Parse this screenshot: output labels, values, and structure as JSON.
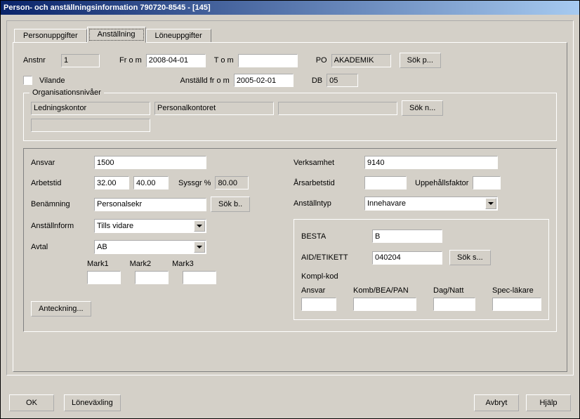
{
  "window": {
    "title": "Person- och anställningsinformation 790720-8545 - [145]"
  },
  "tabs": {
    "personuppgifter": "Personuppgifter",
    "anstallning": "Anställning",
    "loneuppgifter": "Löneuppgifter"
  },
  "top": {
    "anstnr_label": "Anstnr",
    "anstnr": "1",
    "from_label": "Fr o m",
    "from": "2008-04-01",
    "tom_label": "T o m",
    "tom": "",
    "po_label": "PO",
    "po": "AKADEMIK",
    "sokp_btn": "Sök p...",
    "vilande_label": "Vilande",
    "anstalld_from_label": "Anställd fr o m",
    "anstalld_from": "2005-02-01",
    "db_label": "DB",
    "db": "05"
  },
  "org": {
    "legend": "Organisationsnivåer",
    "n1": "Ledningskontor",
    "n2": "Personalkontoret",
    "n3": "",
    "n4": "",
    "sokn_btn": "Sök n..."
  },
  "left": {
    "ansvar_label": "Ansvar",
    "ansvar": "1500",
    "arbetstid_label": "Arbetstid",
    "arbetstid1": "32.00",
    "arbetstid2": "40.00",
    "syssgr_label": "Syssgr %",
    "syssgr": "80.00",
    "benamning_label": "Benämning",
    "benamning": "Personalsekr",
    "sokb_btn": "Sök b..",
    "anstallnform_label": "Anställnform",
    "anstallnform": "Tills vidare",
    "avtal_label": "Avtal",
    "avtal": "AB",
    "mark1": "Mark1",
    "mark2": "Mark2",
    "mark3": "Mark3",
    "anteckning_btn": "Anteckning..."
  },
  "right": {
    "verksamhet_label": "Verksamhet",
    "verksamhet": "9140",
    "arsarbetstid_label": "Årsarbetstid",
    "arsarbetstid": "",
    "uppehall_label": "Uppehållsfaktor",
    "uppehall": "",
    "anstallntyp_label": "Anställntyp",
    "anstallntyp": "Innehavare",
    "besta_label": "BESTA",
    "besta": "B",
    "aid_etikett_label": "AID/ETIKETT",
    "aid_etikett": "040204",
    "soks_btn": "Sök s...",
    "komplkod_label": "Kompl-kod",
    "ansvar_label": "Ansvar",
    "komb_label": "Komb/BEA/PAN",
    "dagnatt_label": "Dag/Natt",
    "speclakare_label": "Spec-läkare"
  },
  "buttons": {
    "ok": "OK",
    "lonevaxling": "Löneväxling",
    "avbryt": "Avbryt",
    "hjalp": "Hjälp"
  }
}
